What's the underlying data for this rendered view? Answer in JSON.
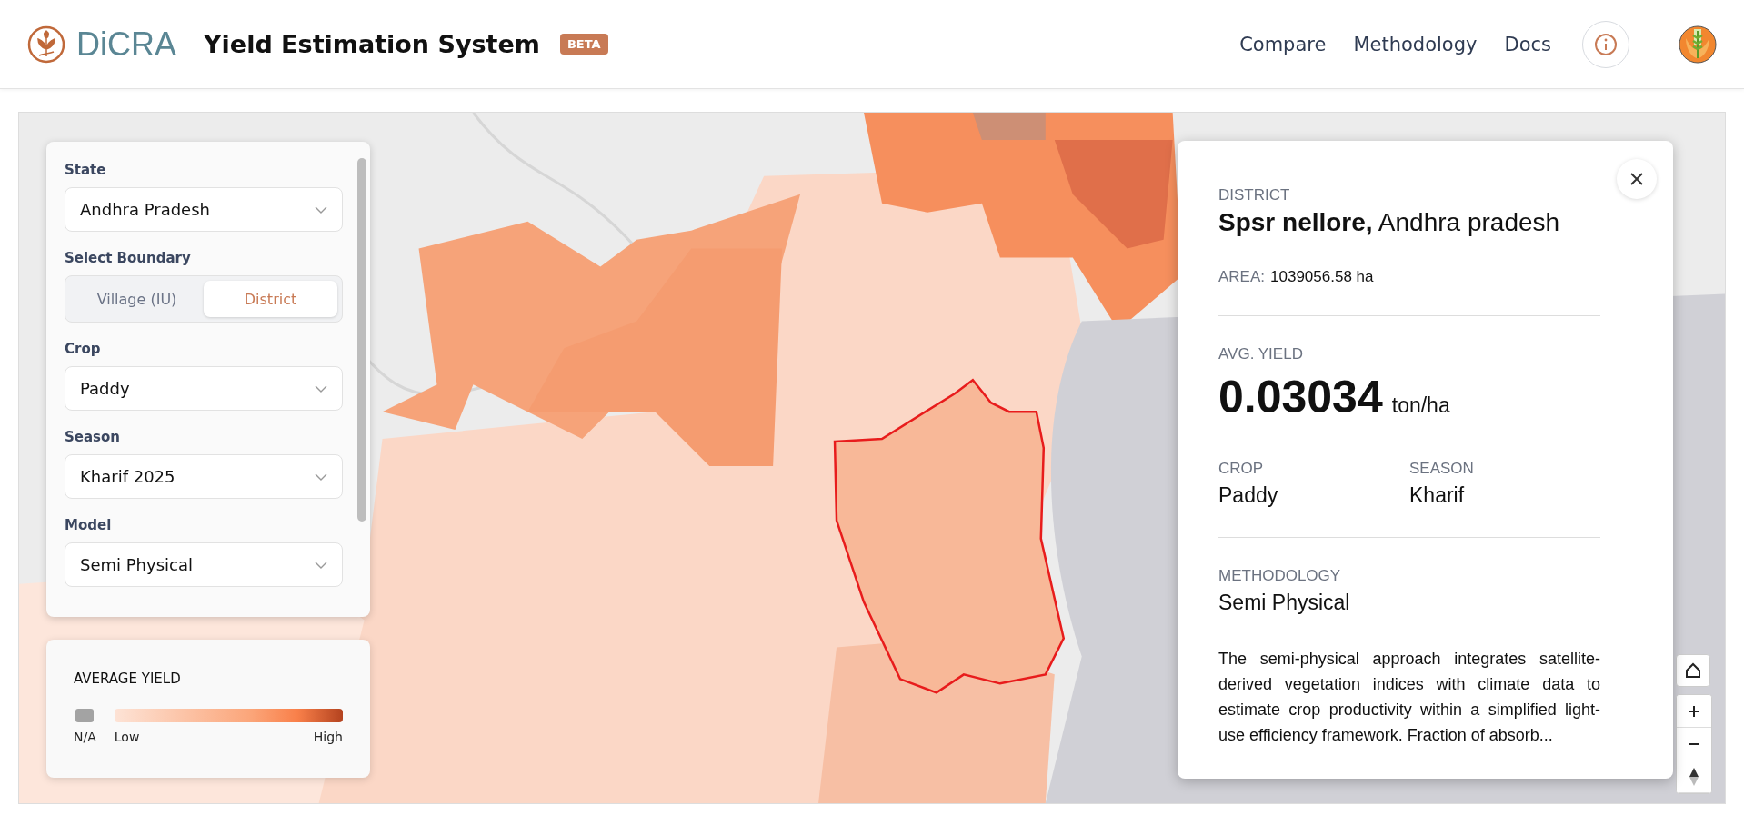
{
  "header": {
    "logo_text": "DiCRA",
    "title": "Yield Estimation System",
    "badge": "BETA",
    "nav": [
      "Compare",
      "Methodology",
      "Docs"
    ]
  },
  "filters": [
    {
      "kind": "select",
      "label": "State",
      "value": "Andhra Pradesh"
    },
    {
      "kind": "segmented",
      "label": "Select Boundary",
      "options": [
        {
          "label": "Village (IU)",
          "selected": false
        },
        {
          "label": "District",
          "selected": true
        }
      ]
    },
    {
      "kind": "select",
      "label": "Crop",
      "value": "Paddy"
    },
    {
      "kind": "select",
      "label": "Season",
      "value": "Kharif 2025"
    },
    {
      "kind": "select",
      "label": "Model",
      "value": "Semi Physical"
    }
  ],
  "legend": {
    "title": "AVERAGE YIELD",
    "na_label": "N/A",
    "low_label": "Low",
    "high_label": "High"
  },
  "detail": {
    "type_label": "DISTRICT",
    "name": "**Spsr nellore,** Andhra pradesh",
    "area_label": "AREA:",
    "area_value": "1039056.58 ha",
    "yield_label": "AVG. YIELD",
    "yield_value": "0.03034",
    "yield_unit": "ton/ha",
    "facts": [
      {
        "label": "CROP",
        "value": "Paddy"
      },
      {
        "label": "SEASON",
        "value": "Kharif"
      }
    ],
    "methodology_label": "METHODOLOGY",
    "methodology_value": "Semi Physical",
    "description": "The semi-physical approach integrates satellite-derived vegetation indices with climate data to estimate crop productivity within a simplified light-use efficiency framework. Fraction of absorb..."
  }
}
